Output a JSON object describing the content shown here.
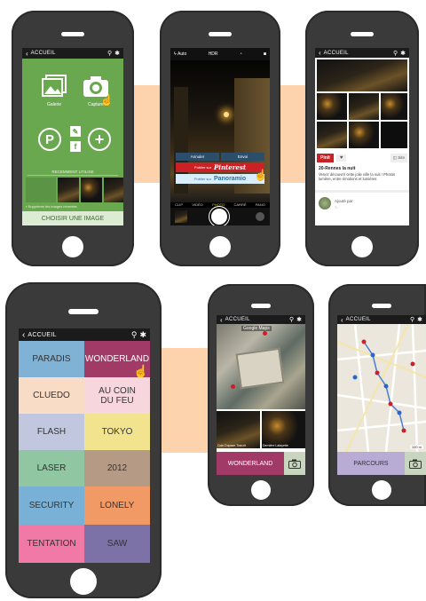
{
  "colors": {
    "connector": "#fcd3ad",
    "phone_body": "#3a3a3a",
    "green": "#6aa84f",
    "paradis": "#7fb2d5",
    "wonderland": "#a23a67",
    "cluedo": "#f9dcc6",
    "au_coin": "#f7d7dd",
    "flash": "#c2c7e0",
    "tokyo": "#f2e48f",
    "laser": "#90c7a2",
    "y2012": "#b59a85",
    "security": "#79b0d6",
    "lonely": "#f29a66",
    "tentation": "#f07aa5",
    "saw": "#7c72a8",
    "parcours": "#b8abd4",
    "pinit": "#cc2027"
  },
  "phone1": {
    "header": "ACCUEIL",
    "gallery_label": "Galerie",
    "capture_label": "Capture",
    "recent_label": "RECEMMENT UTILISE",
    "delete_label": "Supprimer les images récentes",
    "choose_button": "CHOISIR UNE IMAGE",
    "icons": [
      "gallery-icon",
      "camera-icon",
      "pinterest-icon",
      "panoramio-icon",
      "facebook-icon",
      "add-icon"
    ]
  },
  "phone2": {
    "flash": "Auto",
    "hdr": "HDR",
    "annuler": "Annuler",
    "envoi": "Envoi",
    "publier1": "Publier sur",
    "pinterest": "Pinterest",
    "publier2": "Publier sur",
    "panoramio": "Panoramio",
    "modes": [
      "CLIP",
      "VIDÉO",
      "PHOTO",
      "CARRÉ",
      "PANO"
    ]
  },
  "phone3": {
    "header": "ACCUEIL",
    "pinit": "Pinit",
    "like": "♥",
    "site": "Site",
    "title": "20-Rennes la nuit",
    "desc": "Venez découvrir cette jolie ville la nuit ! Photos lumière, entre émotions et lumières",
    "pinned_by": "Ajouté par",
    "pinned_sub": "?..."
  },
  "phone4": {
    "header": "ACCUEIL",
    "themes": [
      [
        "PARADIS",
        "WONDERLAND"
      ],
      [
        "CLUEDO",
        "AU COIN\nDU FEU"
      ],
      [
        "FLASH",
        "TOKYO"
      ],
      [
        "LASER",
        "2012"
      ],
      [
        "SECURITY",
        "LONELY"
      ],
      [
        "TENTATION",
        "SAW"
      ]
    ]
  },
  "phone5": {
    "header": "ACCUEIL",
    "map_label": "Google Maps",
    "caption1": "Coin Dupaze Tranzit",
    "caption2": "Dernière Lafayette",
    "button": "WONDERLAND"
  },
  "phone6": {
    "header": "ACCUEIL",
    "button": "PARCOURS",
    "scale": "100 m"
  }
}
